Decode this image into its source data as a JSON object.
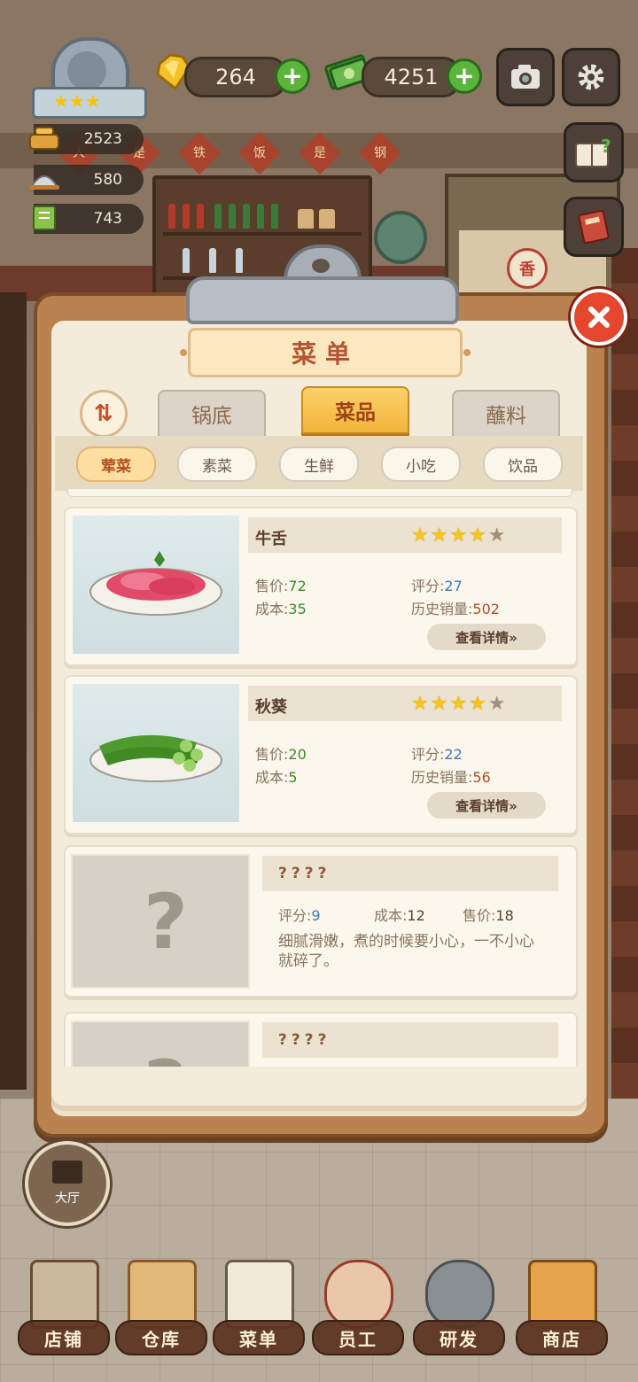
{
  "hud": {
    "gems": "264",
    "cash": "4251",
    "stats": [
      "2523",
      "580",
      "743"
    ],
    "icons": {
      "badge": "rank-badge-icon",
      "gem": "gem-icon",
      "cash": "cash-icon",
      "camera": "camera-icon",
      "settings": "gear-icon",
      "guide": "guide-book-icon",
      "ledger": "ledger-icon",
      "close": "close-icon"
    }
  },
  "wall_chars": [
    "人",
    "是",
    "铁",
    "饭",
    "是",
    "钢"
  ],
  "shop_sign": "香",
  "menu": {
    "title": "菜单",
    "tabs": [
      "锅底",
      "菜品",
      "蘸料"
    ],
    "active_tab": "菜品",
    "categories": [
      "荤菜",
      "素菜",
      "生鲜",
      "小吃",
      "饮品"
    ],
    "active_category": "荤菜",
    "sort_icon": "sort-icon",
    "items": [
      {
        "name": "牛舌",
        "stars": 4,
        "max_stars": 5,
        "price_label": "售价:",
        "price": "72",
        "cost_label": "成本:",
        "cost": "35",
        "score_label": "评分:",
        "score": "27",
        "sales_label": "历史销量:",
        "sales": "502",
        "detail": "查看详情»"
      },
      {
        "name": "秋葵",
        "stars": 4,
        "max_stars": 5,
        "price_label": "售价:",
        "price": "20",
        "cost_label": "成本:",
        "cost": "5",
        "score_label": "评分:",
        "score": "22",
        "sales_label": "历史销量:",
        "sales": "56",
        "detail": "查看详情»"
      }
    ],
    "locked": [
      {
        "name": "????",
        "score_label": "评分:",
        "score": "9",
        "cost_label": "成本:",
        "cost": "12",
        "price_label": "售价:",
        "price": "18",
        "desc": "细腻滑嫩，煮的时候要小心，一不小心就碎了。"
      },
      {
        "name": "????"
      }
    ]
  },
  "lobby": {
    "label": "大厅"
  },
  "nav": [
    "店铺",
    "仓库",
    "菜单",
    "员工",
    "研发",
    "商店"
  ],
  "colors": {
    "accent": "#f2b43b",
    "price": "#3c8a2a",
    "score": "#3d79b9",
    "sales": "#a6522a"
  }
}
